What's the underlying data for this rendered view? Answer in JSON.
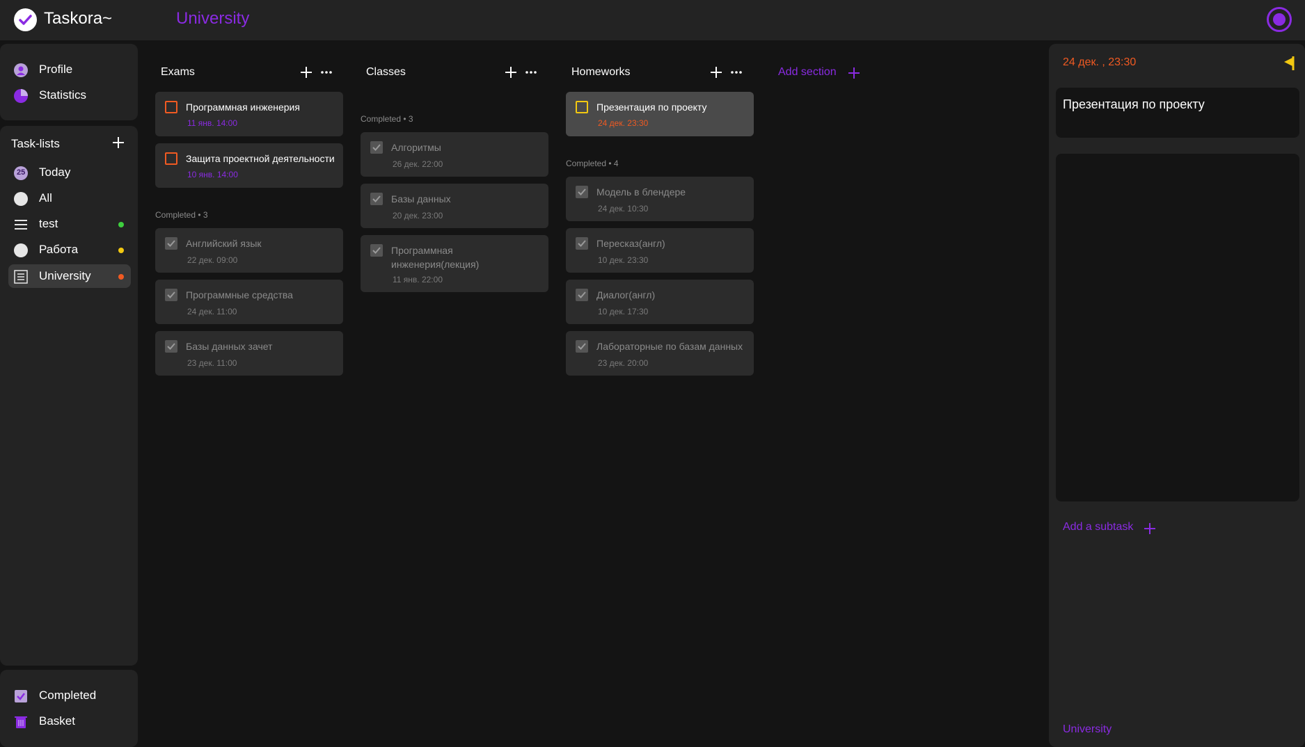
{
  "app": {
    "title": "Taskora~",
    "current_list": "University"
  },
  "nav": {
    "profile": "Profile",
    "statistics": "Statistics",
    "tasklists_header": "Task-lists",
    "today": "Today",
    "today_badge": "25",
    "all": "All",
    "lists": [
      {
        "label": "test",
        "dot_color": "#3ecf3e"
      },
      {
        "label": "Работа",
        "dot_color": "#f2c811"
      },
      {
        "label": "University",
        "dot_color": "#f05a22"
      }
    ],
    "completed": "Completed",
    "basket": "Basket"
  },
  "board": {
    "add_section": "Add section",
    "sections": [
      {
        "title": "Exams",
        "completed_label": "Completed • 3",
        "open": [
          {
            "title": "Программная инженерия",
            "date": "11 янв. 14:00"
          },
          {
            "title": "Защита проектной деятельности",
            "date": "10 янв. 14:00"
          }
        ],
        "done": [
          {
            "title": "Английский язык",
            "date": "22 дек. 09:00"
          },
          {
            "title": "Программные средства",
            "date": "24 дек. 11:00"
          },
          {
            "title": "Базы данных зачет",
            "date": "23 дек. 11:00"
          }
        ]
      },
      {
        "title": "Classes",
        "completed_label": "Completed • 3",
        "open": [],
        "done": [
          {
            "title": "Алгоритмы",
            "date": "26 дек. 22:00"
          },
          {
            "title": "Базы данных",
            "date": "20 дек. 23:00"
          },
          {
            "title": "Программная инженерия(лекция)",
            "date": "11 янв. 22:00"
          }
        ]
      },
      {
        "title": "Homeworks",
        "completed_label": "Completed • 4",
        "open": [
          {
            "title": "Презентация по проекту",
            "date": "24 дек. 23:30"
          }
        ],
        "done": [
          {
            "title": "Модель в блендере",
            "date": "24 дек. 10:30"
          },
          {
            "title": "Пересказ(англ)",
            "date": "10 дек. 23:30"
          },
          {
            "title": "Диалог(англ)",
            "date": "10 дек. 17:30"
          },
          {
            "title": "Лабораторные по базам данных",
            "date": "23 дек. 20:00"
          }
        ]
      }
    ]
  },
  "detail": {
    "date": "24 дек. , 23:30",
    "title": "Презентация по проекту",
    "add_subtask": "Add a subtask",
    "list_name": "University"
  },
  "colors": {
    "accent": "#8a2be2",
    "overdue": "#f05a22",
    "priority": "#f2c811"
  }
}
